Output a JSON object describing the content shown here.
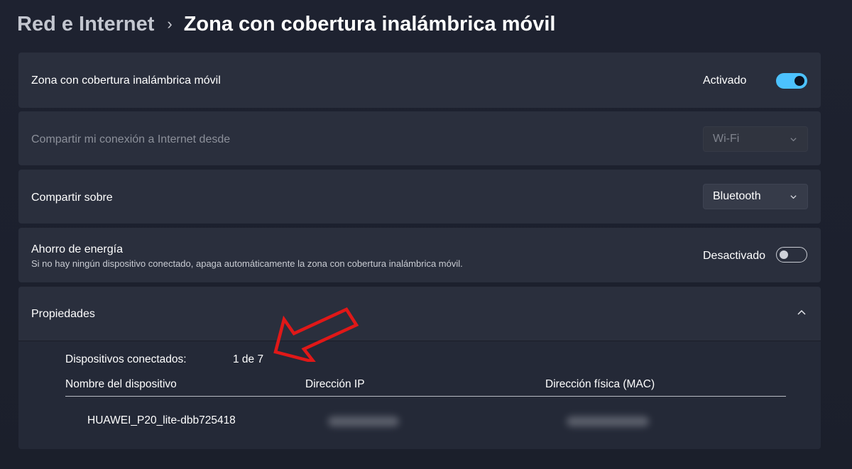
{
  "breadcrumb": {
    "parent": "Red e Internet",
    "separator": "›",
    "current": "Zona con cobertura inalámbrica móvil"
  },
  "hotspot": {
    "label": "Zona con cobertura inalámbrica móvil",
    "state_text": "Activado",
    "enabled": true
  },
  "share_from": {
    "label": "Compartir mi conexión a Internet desde",
    "value": "Wi-Fi",
    "disabled": true
  },
  "share_over": {
    "label": "Compartir sobre",
    "value": "Bluetooth"
  },
  "power_saving": {
    "title": "Ahorro de energía",
    "description": "Si no hay ningún dispositivo conectado, apaga automáticamente la zona con cobertura inalámbrica móvil.",
    "state_text": "Desactivado",
    "enabled": false
  },
  "properties": {
    "title": "Propiedades",
    "expanded": true,
    "connected_label": "Dispositivos conectados:",
    "connected_value": "1 de 7",
    "columns": [
      "Nombre del dispositivo",
      "Dirección IP",
      "Dirección física (MAC)"
    ],
    "devices": [
      {
        "name": "HUAWEI_P20_lite-dbb725418"
      }
    ]
  },
  "icons": {
    "chevron_down": "chevron-down-icon",
    "chevron_up": "chevron-up-icon",
    "annotation_arrow": "red-arrow-annotation"
  },
  "colors": {
    "accent": "#4cc2ff",
    "background": "#1e2230",
    "card": "#2a2f3d",
    "annotation": "#e01818"
  }
}
